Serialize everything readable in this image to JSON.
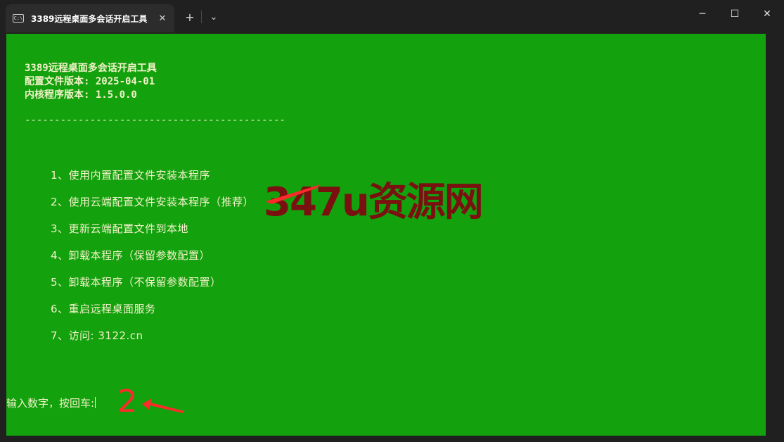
{
  "window": {
    "tab_title": "3389远程桌面多会话开启工具",
    "tab_icon_glyph": "C:\\",
    "close_tab_glyph": "✕",
    "new_tab_glyph": "+",
    "dropdown_glyph": "⌄",
    "minimize_glyph": "─",
    "maximize_glyph": "☐",
    "close_glyph": "✕"
  },
  "terminal": {
    "background": "#13a10e",
    "foreground": "#f2f2c8",
    "header": {
      "title": "3389远程桌面多会话开启工具",
      "config_version": "配置文件版本: 2025-04-01",
      "kernel_version": "内核程序版本: 1.5.0.0",
      "divider": "--------------------------------------------"
    },
    "menu": [
      "1、使用内置配置文件安装本程序",
      "2、使用云端配置文件安装本程序（推荐）",
      "3、更新云端配置文件到本地",
      "4、卸载本程序（保留参数配置）",
      "5、卸载本程序（不保留参数配置）",
      "6、重启远程桌面服务",
      "7、访问: 3122.cn"
    ],
    "prompt": "输入数字，按回车:",
    "typed_value": "2"
  },
  "overlay": {
    "watermark": "347u资源网",
    "watermark_color": "#7a1010",
    "arrow_color": "#ff2a2a"
  }
}
